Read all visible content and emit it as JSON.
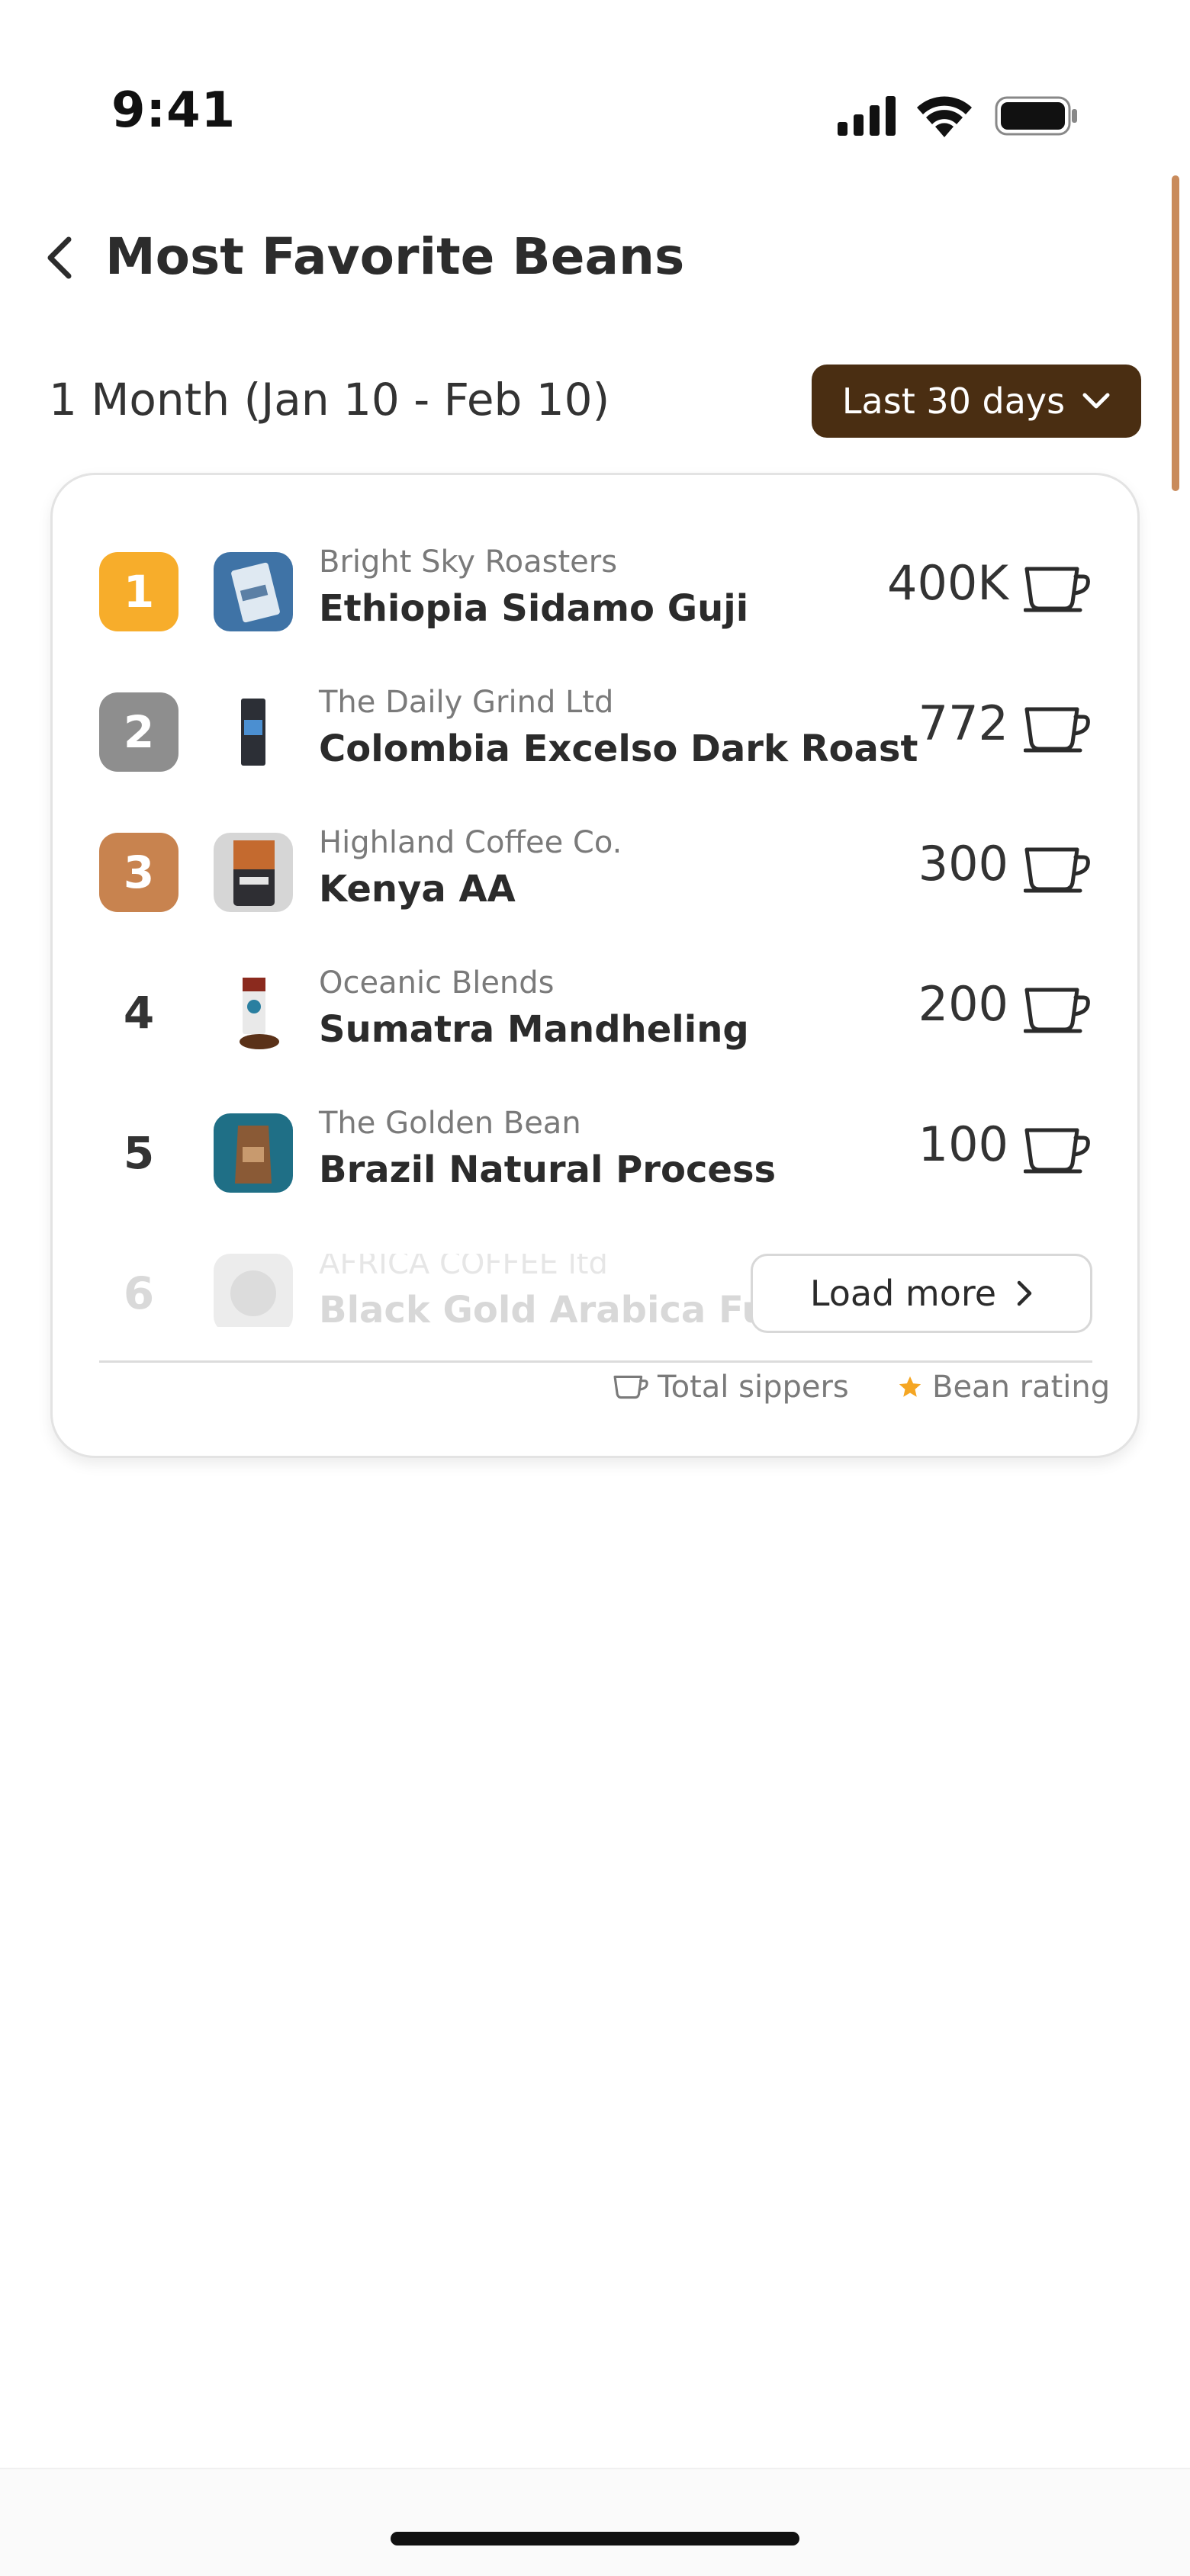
{
  "status_bar": {
    "time": "9:41"
  },
  "header": {
    "title": "Most Favorite Beans"
  },
  "period": {
    "label": "1 Month (Jan 10 - Feb 10)",
    "selected_range": "Last 30 days"
  },
  "colors": {
    "gold": "#f7ad2b",
    "silver": "#8e8e8e",
    "bronze": "#c8834f",
    "accent_dark": "#4a2e12",
    "star": "#f5a623"
  },
  "ranking": [
    {
      "rank": "1",
      "roaster": "Bright Sky Roasters",
      "bean": "Ethiopia Sidamo Guji",
      "sippers": "400K"
    },
    {
      "rank": "2",
      "roaster": "The Daily Grind Ltd",
      "bean": "Colombia Excelso Dark Roast",
      "sippers": "772"
    },
    {
      "rank": "3",
      "roaster": "Highland Coffee Co.",
      "bean": "Kenya AA",
      "sippers": "300"
    },
    {
      "rank": "4",
      "roaster": "Oceanic Blends",
      "bean": "Sumatra Mandheling",
      "sippers": "200"
    },
    {
      "rank": "5",
      "roaster": "The Golden Bean",
      "bean": "Brazil Natural Process",
      "sippers": "100"
    },
    {
      "rank": "6",
      "roaster": "AFRICA COFFEE ltd",
      "bean": "Black Gold Arabica Full"
    }
  ],
  "load_more_label": "Load more",
  "legend": {
    "sippers": "Total sippers",
    "rating": "Bean rating"
  }
}
